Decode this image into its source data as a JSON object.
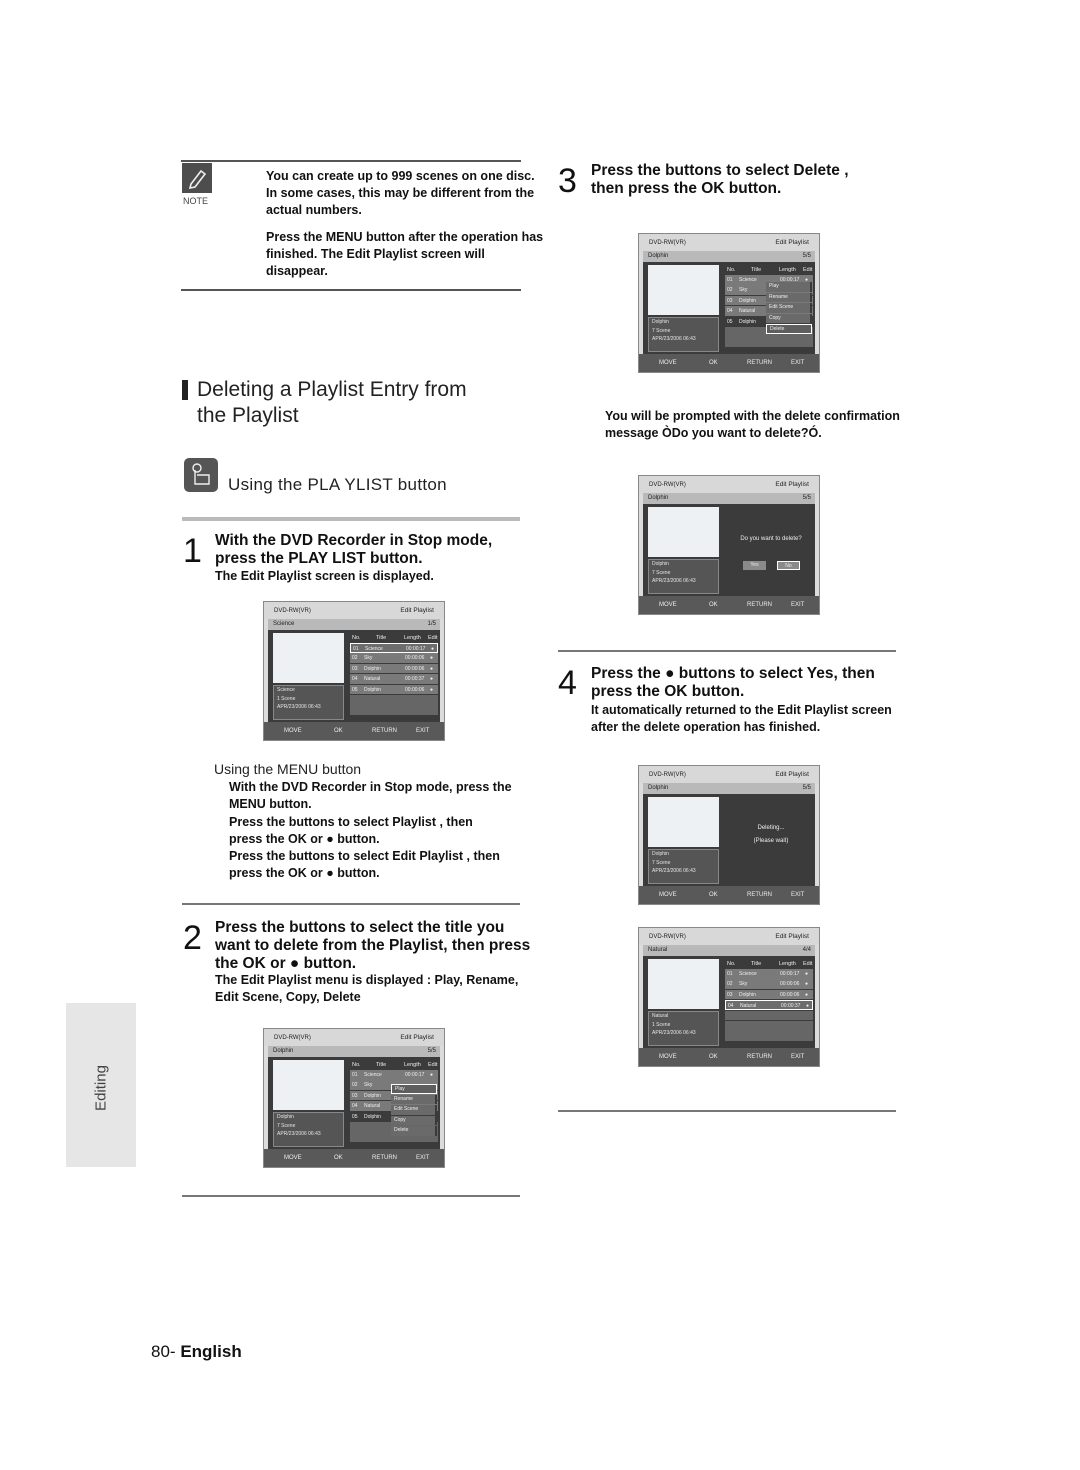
{
  "note": {
    "label": "NOTE",
    "items": [
      "You can create up to 999 scenes on one disc. In some cases, this may be different from the actual numbers.",
      "Press the MENU button after the operation has finished. The Edit Playlist screen will disappear."
    ]
  },
  "section": {
    "title_line1": "Deleting a Playlist Entry from",
    "title_line2": "the Playlist",
    "subtitle": "Using the PLA YLIST button"
  },
  "steps": {
    "s1": {
      "num": "1",
      "head_line1": "With the DVD Recorder in Stop mode,",
      "head_line2": "press the PLAY LIST  button.",
      "body": "The Edit Playlist screen is displayed."
    },
    "menu": {
      "title": "Using the MENU button",
      "lines": [
        "With the DVD Recorder in Stop mode, press the",
        "MENU button.",
        "Press the       buttons to select Playlist , then",
        "press the OK or ● button.",
        "Press the       buttons to select Edit Playlist , then",
        "press the OK or ● button."
      ]
    },
    "s2": {
      "num": "2",
      "head_line1": "Press the       buttons to select the title you",
      "head_line2": "want to delete from the Playlist, then press",
      "head_line3": "the OK or ● button.",
      "body_line1": "The Edit Playlist menu is displayed : Play, Rename,",
      "body_line2": "Edit Scene, Copy, Delete"
    },
    "s3": {
      "num": "3",
      "head_line1": "Press the       buttons to select Delete ,",
      "head_line2": "then press the OK button.",
      "body_line1": "You will be prompted with the delete confirmation",
      "body_line2": "message ÒDo you want to delete?Ó."
    },
    "s4": {
      "num": "4",
      "head_line1": "Press the ●    buttons to select Yes, then",
      "head_line2": "press the OK button.",
      "body_line1": "It automatically returned to the Edit Playlist screen",
      "body_line2": "after the delete operation has finished."
    }
  },
  "osd_common": {
    "device": "DVD-RW(VR)",
    "title": "Edit Playlist",
    "col_no": "No.",
    "col_title": "Title",
    "col_length": "Length",
    "col_edit": "Edit",
    "foot_move": "MOVE",
    "foot_ok": "OK",
    "foot_return": "RETURN",
    "foot_exit": "EXIT"
  },
  "screens": {
    "a": {
      "name": "Science",
      "page": "1/5",
      "info": [
        "Science",
        "1 Scene",
        "APR/23/2006 06:43"
      ],
      "rows": [
        {
          "no": "01",
          "title": "Science",
          "length": "00:00:17"
        },
        {
          "no": "02",
          "title": "Sky",
          "length": "00:00:06"
        },
        {
          "no": "03",
          "title": "Dolphin",
          "length": "00:00:06"
        },
        {
          "no": "04",
          "title": "Natural",
          "length": "00:00:37"
        },
        {
          "no": "05",
          "title": "Dolphin",
          "length": "00:00:06"
        }
      ]
    },
    "b": {
      "name": "Dolphin",
      "page": "5/5",
      "info": [
        "Dolphin",
        "7 Scene",
        "APR/23/2006 06:43"
      ],
      "rows": [
        {
          "no": "01",
          "title": "Science",
          "length": "00:00:17"
        },
        {
          "no": "02",
          "title": "Sky",
          "length": ""
        },
        {
          "no": "03",
          "title": "Dolphin",
          "length": ""
        },
        {
          "no": "04",
          "title": "Natural",
          "length": ""
        },
        {
          "no": "05",
          "title": "Dolphin",
          "length": ""
        }
      ],
      "menu": [
        "Play",
        "Rename",
        "Edit Scene",
        "Copy",
        "Delete"
      ]
    },
    "c": {
      "name": "Dolphin",
      "page": "5/5",
      "info": [
        "Dolphin",
        "7 Scene",
        "APR/23/2006 06:43"
      ],
      "rows": [
        {
          "no": "01",
          "title": "Science",
          "length": "00:00:17"
        },
        {
          "no": "02",
          "title": "Sky",
          "length": ""
        },
        {
          "no": "03",
          "title": "Dolphin",
          "length": ""
        },
        {
          "no": "04",
          "title": "Natural",
          "length": ""
        },
        {
          "no": "05",
          "title": "Dolphin",
          "length": ""
        }
      ],
      "menu": [
        "Play",
        "Rename",
        "Edit Scene",
        "Copy",
        "Delete"
      ]
    },
    "d": {
      "name": "Dolphin",
      "page": "5/5",
      "info": [
        "Dolphin",
        "7 Scene",
        "APR/23/2006 06:43"
      ],
      "message": "Do you want to delete?",
      "yes": "Yes",
      "no": "No"
    },
    "e": {
      "name": "Dolphin",
      "page": "5/5",
      "info": [
        "Dolphin",
        "7 Scene",
        "APR/23/2006 06:43"
      ],
      "message1": "Deleting...",
      "message2": "(Please wait)"
    },
    "f": {
      "name": "Natural",
      "page": "4/4",
      "info": [
        "Natural",
        "1 Scene",
        "APR/23/2006 06:43"
      ],
      "rows": [
        {
          "no": "01",
          "title": "Science",
          "length": "00:00:17"
        },
        {
          "no": "02",
          "title": "Sky",
          "length": "00:00:06"
        },
        {
          "no": "03",
          "title": "Dolphin",
          "length": "00:00:06"
        },
        {
          "no": "04",
          "title": "Natural",
          "length": "00:00:37"
        }
      ]
    }
  },
  "side_tab": "Editing",
  "footer": {
    "page_number": "80-",
    "language": "English"
  }
}
